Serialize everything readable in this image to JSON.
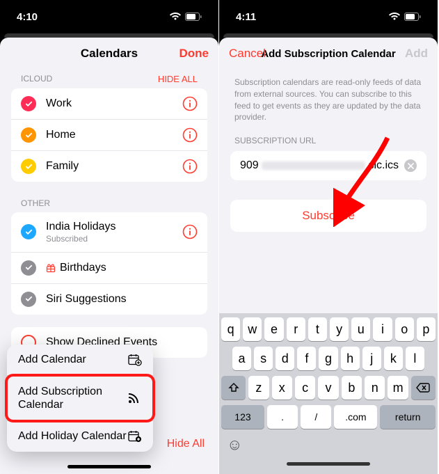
{
  "left": {
    "time": "4:10",
    "nav_title": "Calendars",
    "nav_done": "Done",
    "sections": {
      "icloud": {
        "header": "ICLOUD",
        "hide_all": "HIDE ALL",
        "items": [
          {
            "label": "Work",
            "color": "#ff2d55"
          },
          {
            "label": "Home",
            "color": "#ff9500"
          },
          {
            "label": "Family",
            "color": "#ffcc00"
          }
        ]
      },
      "other": {
        "header": "OTHER",
        "items": [
          {
            "label": "India Holidays",
            "sublabel": "Subscribed",
            "color": "#1ea7ff",
            "info": true
          },
          {
            "label": "Birthdays",
            "icon": "gift",
            "color": "#8e8e93"
          },
          {
            "label": "Siri Suggestions",
            "color": "#8e8e93"
          }
        ]
      }
    },
    "declined": "Show Declined Events",
    "add_menu": {
      "add_calendar": "Add Calendar",
      "add_subscription": "Add Subscription Calendar",
      "add_holiday": "Add Holiday Calendar"
    },
    "toolbar": {
      "add_calendar": "Add Calendar",
      "hide_all": "Hide All"
    }
  },
  "right": {
    "time": "4:11",
    "nav_cancel": "Cancel",
    "nav_title": "Add Subscription Calendar",
    "nav_add": "Add",
    "description": "Subscription calendars are read-only feeds of data from external sources. You can subscribe to this feed to get events as they are updated by the data provider.",
    "field_label": "SUBSCRIPTION URL",
    "url_prefix": "909",
    "url_suffix": "sic.ics",
    "subscribe": "Subscribe",
    "keyboard": {
      "row1": [
        "q",
        "w",
        "e",
        "r",
        "t",
        "y",
        "u",
        "i",
        "o",
        "p"
      ],
      "row2": [
        "a",
        "s",
        "d",
        "f",
        "g",
        "h",
        "j",
        "k",
        "l"
      ],
      "row3": [
        "z",
        "x",
        "c",
        "v",
        "b",
        "n",
        "m"
      ],
      "bottom": {
        "num": "123",
        "dot": ".",
        "slash": "/",
        "com": ".com",
        "ret": "return"
      }
    }
  }
}
